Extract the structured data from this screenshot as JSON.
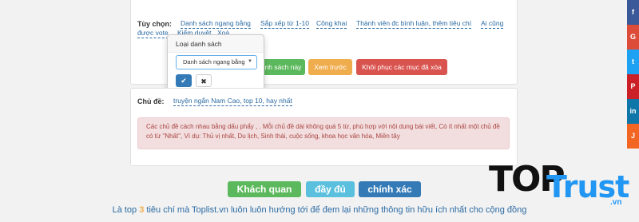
{
  "options_row": {
    "label": "Tùy chọn:",
    "items": [
      "Danh sách ngang bằng",
      "Sắp xếp từ 1-10",
      "Công khai",
      "Thành viên đc bình luận, thêm tiêu chí",
      "Ai cũng",
      "được vote",
      "Kiểm duyệt",
      "Xoá"
    ]
  },
  "buttons": {
    "partial_save": "nh sách này",
    "preview": "Xem trước",
    "restore": "Khôi phục các mục đã xóa"
  },
  "popover": {
    "title": "Loại danh sách",
    "selected": "Danh sách ngang bằng",
    "ok_icon": "✔",
    "cancel_icon": "✖"
  },
  "topic": {
    "label": "Chủ đề:",
    "value": "truyện ngắn Nam Cao, top 10, hay nhất",
    "alert": "Các chủ đề cách nhau bằng dấu phẩy , . Mỗi chủ đề dài không quá 5 từ, phù hợp với nội dung bài viết, Có ít nhất một chủ đề có từ \"Nhất\", Ví dụ: Thủ vị nhất, Du lịch, Sinh thái, cuộc sống, khoa học văn hóa, Miền tây"
  },
  "tags": [
    "Khách quan",
    "đầy đủ",
    "chính xác"
  ],
  "footer": {
    "prefix": "Là top ",
    "number": "3",
    "suffix": " tiêu chí mà Toplist.vn luôn luôn hướng tới để đem lại những thông tin hữu ích nhất cho cộng đồng"
  },
  "social": [
    {
      "icon": "facebook-icon",
      "glyph": "f",
      "color": "#3b5998"
    },
    {
      "icon": "google-plus-icon",
      "glyph": "G",
      "color": "#dd4b39"
    },
    {
      "icon": "twitter-icon",
      "glyph": "t",
      "color": "#1da1f2"
    },
    {
      "icon": "pinterest-icon",
      "glyph": "P",
      "color": "#cb2027"
    },
    {
      "icon": "linkedin-icon",
      "glyph": "in",
      "color": "#0e76a8"
    },
    {
      "icon": "share-icon",
      "glyph": "J",
      "color": "#f26522"
    }
  ],
  "logo": {
    "top": "TOP",
    "trust": "Trust",
    "vn": ".vn"
  }
}
